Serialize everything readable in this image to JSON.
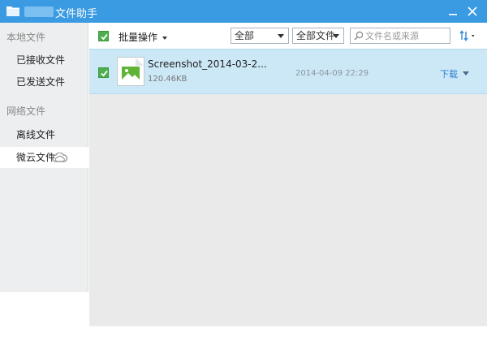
{
  "titlebar": {
    "title": "文件助手"
  },
  "sidebar": {
    "local_header": "本地文件",
    "received": "已接收文件",
    "sent": "已发送文件",
    "network_header": "网络文件",
    "offline": "离线文件",
    "weiyun": "微云文件"
  },
  "toolbar": {
    "batch_label": "批量操作",
    "filter_all": "全部",
    "filter_type": "全部文件",
    "search_placeholder": "文件名或来源"
  },
  "files": [
    {
      "name": "Screenshot_2014-03-2...",
      "size": "120.46KB",
      "date": "2014-04-09 22:29",
      "action": "下载",
      "checked": true
    }
  ],
  "colors": {
    "titlebar": "#3a9ae2",
    "sidebar_bg": "#eceeef",
    "selected_row": "#cce8f7",
    "checkbox": "#4cae4c",
    "link": "#2a7fd0"
  }
}
